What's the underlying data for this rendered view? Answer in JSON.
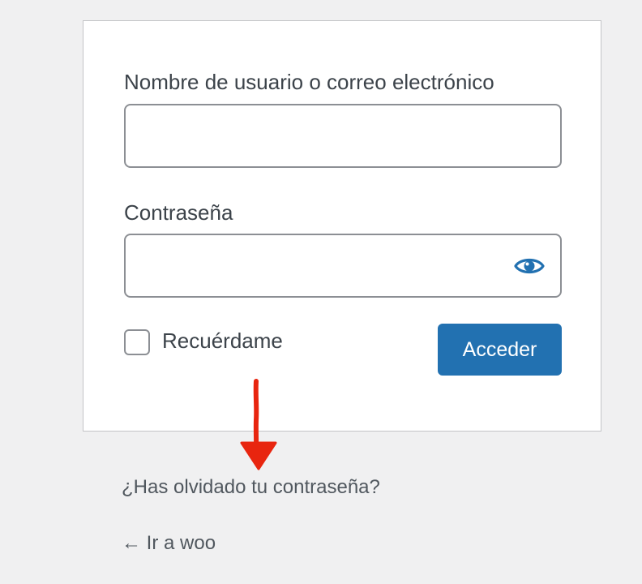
{
  "form": {
    "username_label": "Nombre de usuario o correo electrónico",
    "username_value": "",
    "password_label": "Contraseña",
    "password_value": "",
    "password_toggle_icon": "eye-icon",
    "remember_label": "Recuérdame",
    "remember_checked": false,
    "submit_label": "Acceder"
  },
  "links": {
    "lost_password": "¿Has olvidado tu contraseña?",
    "back_to_site": "← Ir a woo"
  },
  "annotation": {
    "arrow_icon": "arrow-down-icon",
    "color": "#e8250f"
  },
  "colors": {
    "accent": "#2271b1",
    "background": "#f0f0f1",
    "text": "#3c434a"
  }
}
